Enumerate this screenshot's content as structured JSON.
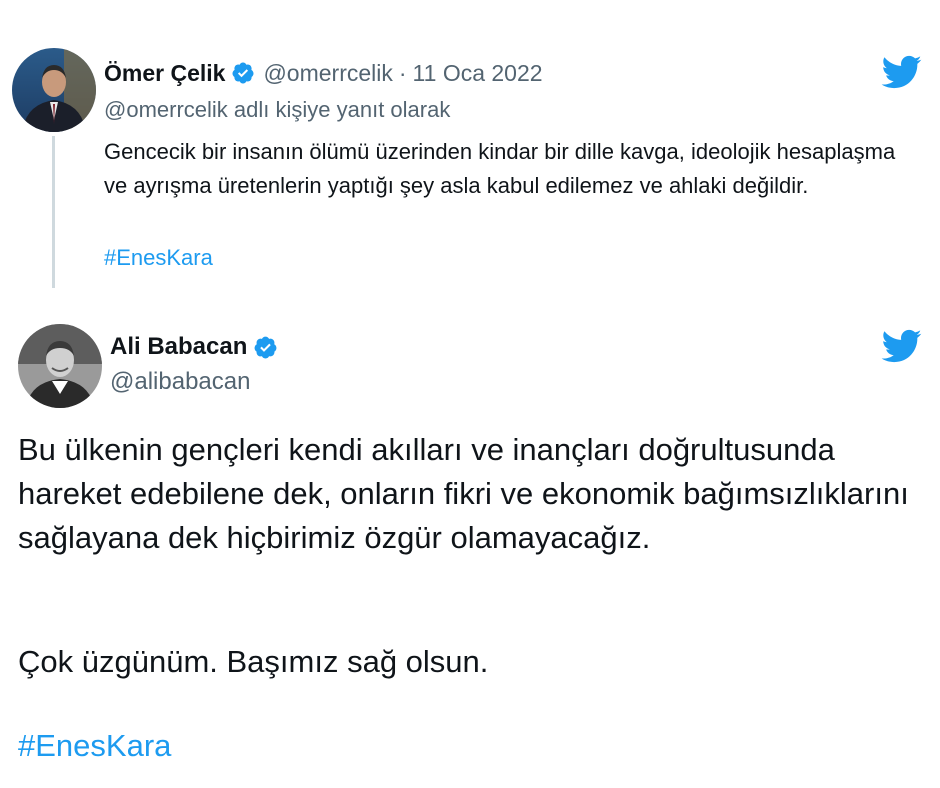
{
  "tweets": [
    {
      "author": {
        "name": "Ömer Çelik",
        "handle": "@omerrcelik",
        "verified": true
      },
      "date": "11 Oca 2022",
      "meta_separator": "·",
      "replying_to": "@omerrcelik adlı kişiye yanıt olarak",
      "text": "Gencecik bir insanın ölümü üzerinden kindar bir dille kavga, ideolojik hesaplaşma ve ayrışma üretenlerin yaptığı şey asla kabul edilemez ve ahlaki değildir.",
      "hashtag": "#EnesKara"
    },
    {
      "author": {
        "name": "Ali Babacan",
        "handle": "@alibabacan",
        "verified": true
      },
      "text": "Bu ülkenin gençleri kendi akılları ve inançları doğrultusunda hareket edebilene dek, onların fikri ve ekonomik bağımsızlıklarını sağlayana dek hiçbirimiz özgür olamayacağız.",
      "text2": "Çok üzgünüm. Başımız sağ olsun.",
      "hashtag": "#EnesKara"
    }
  ],
  "icons": {
    "verified": "verified-badge-icon",
    "brand": "twitter-bird-icon"
  },
  "colors": {
    "accent": "#1d9bf0",
    "secondary_text": "#536471",
    "primary_text": "#0f1419",
    "thread_line": "#cfd9de"
  }
}
